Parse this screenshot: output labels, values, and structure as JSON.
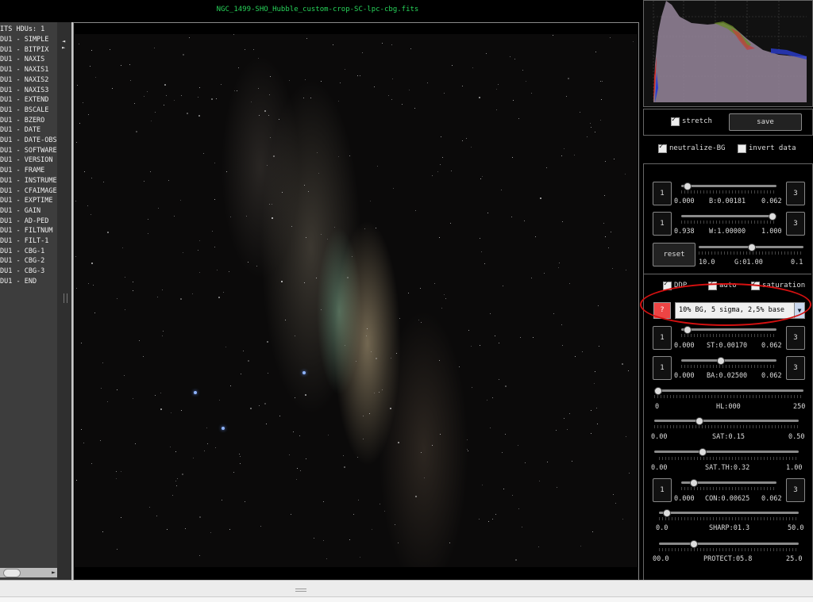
{
  "window": {
    "title": "NGC_1499-SHO_Hubble_custom-crop-SC-lpc-cbg.fits"
  },
  "hdu_list": {
    "header": "ITS HDUs: 1",
    "items": [
      "DU1 - SIMPLE",
      "DU1 - BITPIX",
      "DU1 - NAXIS",
      "DU1 - NAXIS1",
      "DU1 - NAXIS2",
      "DU1 - NAXIS3",
      "DU1 - EXTEND",
      "DU1 - BSCALE",
      "DU1 - BZERO",
      "DU1 - DATE",
      "DU1 - DATE-OBS",
      "DU1 - SOFTWARE",
      "DU1 - VERSION",
      "DU1 - FRAME",
      "DU1 - INSTRUME",
      "DU1 - CFAIMAGE",
      "DU1 - EXPTIME",
      "DU1 - GAIN",
      "DU1 - AD-PED",
      "DU1 - FILTNUM",
      "DU1 - FILT-1",
      "DU1 - CBG-1",
      "DU1 - CBG-2",
      "DU1 - CBG-3",
      "DU1 - END"
    ]
  },
  "controls": {
    "stretch": {
      "label": "stretch",
      "checked": true
    },
    "save_label": "save",
    "neutralize_bg": {
      "label": "neutralize-BG",
      "checked": true
    },
    "invert_data": {
      "label": "invert data",
      "checked": false
    },
    "b_slider": {
      "btn_left": "1",
      "btn_right": "3",
      "min": "0.000",
      "label": "B:0.00181",
      "max": "0.062",
      "position": 0.03
    },
    "w_slider": {
      "btn_left": "1",
      "btn_right": "3",
      "min": "0.938",
      "label": "W:1.00000",
      "max": "1.000",
      "position": 0.98
    },
    "reset_label": "reset",
    "g_slider": {
      "min": "10.0",
      "label": "G:01.00",
      "max": "0.1",
      "position": 0.5
    },
    "ddp": {
      "label": "DDP",
      "checked": true
    },
    "auto": {
      "label": "auto",
      "checked": true
    },
    "saturation": {
      "label": "saturation",
      "checked": true
    },
    "preset_button": "?",
    "preset_value": "10% BG, 5 sigma, 2,5% base",
    "st_slider": {
      "btn_left": "1",
      "btn_right": "3",
      "min": "0.000",
      "label": "ST:0.00170",
      "max": "0.062",
      "position": 0.03
    },
    "ba_slider": {
      "btn_left": "1",
      "btn_right": "3",
      "min": "0.000",
      "label": "BA:0.02500",
      "max": "0.062",
      "position": 0.4
    },
    "hl_slider": {
      "min": "0",
      "label": "HL:000",
      "max": "250",
      "position": 0.0
    },
    "sat_slider": {
      "min": "0.00",
      "label": "SAT:0.15",
      "max": "0.50",
      "position": 0.3
    },
    "satth_slider": {
      "min": "0.00",
      "label": "SAT.TH:0.32",
      "max": "1.00",
      "position": 0.32
    },
    "con_slider": {
      "btn_left": "1",
      "btn_right": "3",
      "min": "0.000",
      "label": "CON:0.00625",
      "max": "0.062",
      "position": 0.1
    },
    "sharp_slider": {
      "min": "0.0",
      "label": "SHARP:01.3",
      "max": "50.0",
      "position": 0.03
    },
    "protect_slider": {
      "min": "00.0",
      "label": "PROTECT:05.8",
      "max": "25.0",
      "position": 0.23
    }
  },
  "colors": {
    "title": "#27d35a",
    "highlight_circle": "#d41010",
    "preset_button": "#ee4444"
  }
}
